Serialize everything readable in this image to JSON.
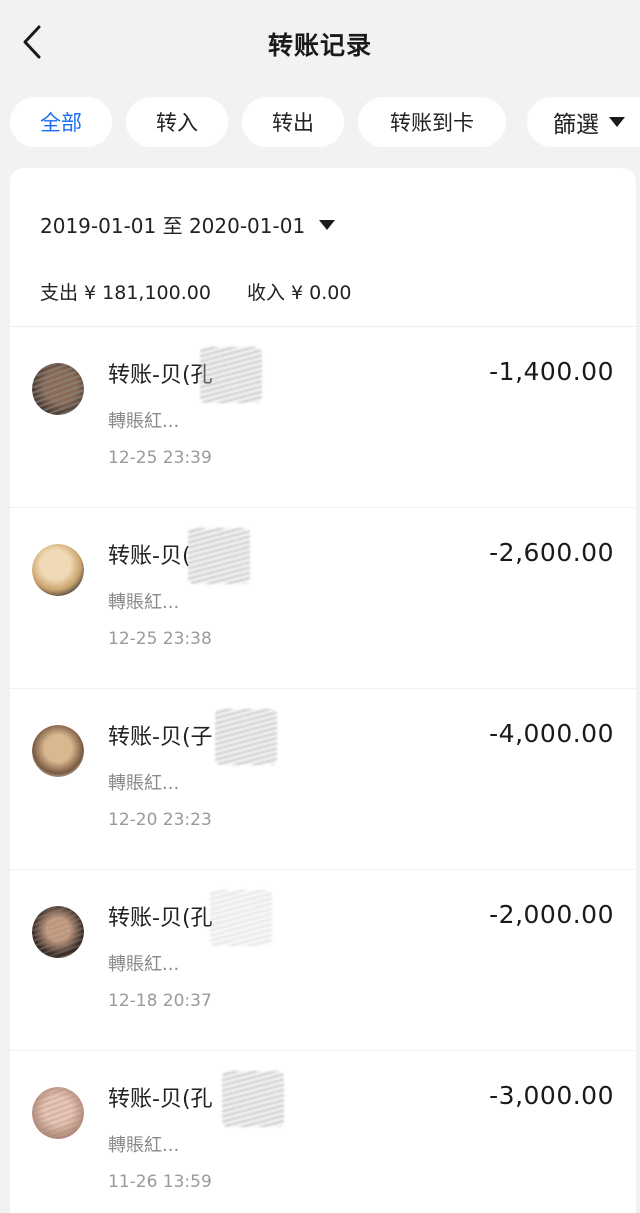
{
  "header": {
    "title": "转账记录",
    "back_icon": "chevron-left-icon"
  },
  "filters": {
    "tabs": [
      "全部",
      "转入",
      "转出",
      "转账到卡"
    ],
    "active_index": 0,
    "active_color": "#1b6ef3",
    "filter_label": "篩選",
    "filter_icon": "triangle-down-icon"
  },
  "range": {
    "label": "2019-01-01 至 2020-01-01",
    "icon": "triangle-down-icon"
  },
  "summary": {
    "expense": "支出 ¥ 181,100.00",
    "income": "收入 ¥ 0.00"
  },
  "transactions": [
    {
      "name": "转账-贝(孔",
      "memo": "轉賬紅...",
      "time": "12-25 23:39",
      "amount": "-1,400.00"
    },
    {
      "name": "转账-贝(",
      "memo": "轉賬紅...",
      "time": "12-25 23:38",
      "amount": "-2,600.00"
    },
    {
      "name": "转账-贝(子",
      "memo": "轉賬紅...",
      "time": "12-20 23:23",
      "amount": "-4,000.00"
    },
    {
      "name": "转账-贝(孔",
      "memo": "轉賬紅...",
      "time": "12-18 20:37",
      "amount": "-2,000.00"
    },
    {
      "name": "转账-贝(孔",
      "memo": "轉賬紅...",
      "time": "11-26 13:59",
      "amount": "-3,000.00"
    }
  ]
}
